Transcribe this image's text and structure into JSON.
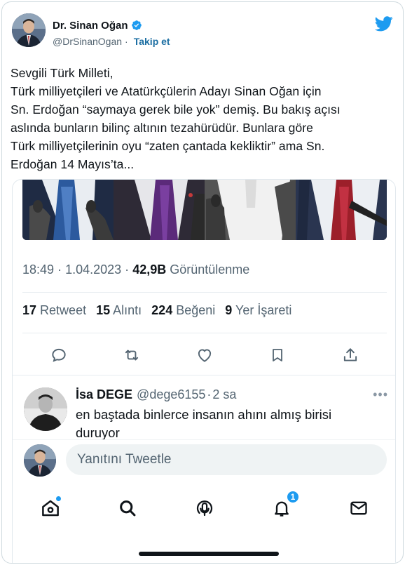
{
  "author": {
    "display_name": "Dr. Sinan Oğan",
    "handle": "@DrSinanOgan",
    "separator": "·",
    "follow_label": "Takip et",
    "verified_icon": "verified-badge-icon"
  },
  "brand": {
    "logo": "twitter-bird-icon",
    "color": "#1d9bf0"
  },
  "tweet": {
    "lines": [
      "Sevgili Türk Milleti,",
      "Türk milliyetçileri ve Atatürkçülerin Adayı Sinan Oğan için",
      "Sn. Erdoğan “saymaya gerek bile yok” demiş. Bu bakış açısı",
      "aslında bunların bilinç altının tezahürüdür. Bunlara göre",
      "Türk milliyetçilerinin oyu “zaten çantada keklik‏tir” ama Sn.",
      "Erdoğan 14 Mayıs’ta..."
    ]
  },
  "embedded": {
    "meta": {
      "time": "18:49",
      "date": "1.04.2023",
      "separator": "·",
      "views": "42,9B",
      "views_label": "Görüntülenme"
    },
    "stats": [
      {
        "count": "17",
        "label": "Retweet"
      },
      {
        "count": "15",
        "label": "Alıntı"
      },
      {
        "count": "224",
        "label": "Beğeni"
      },
      {
        "count": "9",
        "label": "Yer İşareti"
      }
    ],
    "actions": [
      "reply-icon",
      "retweet-icon",
      "like-icon",
      "bookmark-icon",
      "share-icon"
    ],
    "reply": {
      "name": "İsa DEGE",
      "handle": "@dege6155",
      "separator": "·",
      "time": "2 sa",
      "more": "•••",
      "text_line1": "en baştada binlerce insanın ahını almış birisi",
      "text_line2": "duruyor"
    },
    "compose": {
      "placeholder": "Yanıtını Tweetle"
    },
    "nav": {
      "items": [
        "home-icon",
        "search-icon",
        "spaces-icon",
        "notifications-icon",
        "messages-icon"
      ],
      "notification_count": "1"
    }
  }
}
